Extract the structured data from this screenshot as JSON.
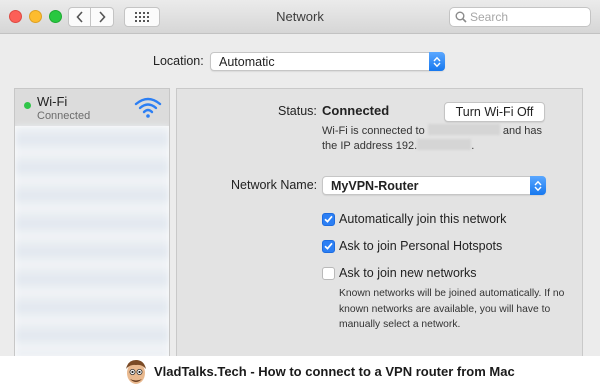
{
  "window": {
    "title": "Network",
    "search_placeholder": "Search"
  },
  "icons": {
    "back": "chevron-left-icon",
    "forward": "chevron-right-icon",
    "grid": "grid-icon",
    "search": "search-icon",
    "wifi": "wifi-icon",
    "popup": "updown-arrows-icon",
    "check": "checkmark-icon"
  },
  "location": {
    "label": "Location:",
    "value": "Automatic"
  },
  "sidebar": {
    "items": [
      {
        "name": "Wi-Fi",
        "status": "Connected",
        "status_color": "#30c549"
      }
    ]
  },
  "status": {
    "label": "Status:",
    "value": "Connected",
    "button_label": "Turn Wi-Fi Off",
    "desc_part1": "Wi-Fi is connected to",
    "desc_part2": "and has",
    "desc_part3": "the IP address 192.",
    "desc_part4": "."
  },
  "network": {
    "label": "Network Name:",
    "value": "MyVPN-Router"
  },
  "options": [
    {
      "label": "Automatically join this network",
      "checked": true
    },
    {
      "label": "Ask to join Personal Hotspots",
      "checked": true
    },
    {
      "label": "Ask to join new networks",
      "checked": false
    }
  ],
  "note": "Known networks will be joined automatically. If no known networks are available, you will have to manually select a network.",
  "caption": "VladTalks.Tech - How to connect to a VPN router from Mac",
  "colors": {
    "accent": "#2c7ff4",
    "connected": "#30c549"
  }
}
